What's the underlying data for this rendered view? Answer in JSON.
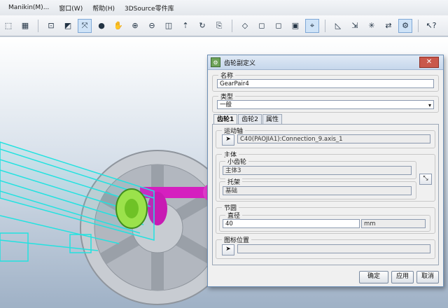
{
  "menubar": {
    "items": [
      "Manikin(M)...",
      "窗口(W)",
      "帮助(H)",
      "3DSource零件库"
    ]
  },
  "colors": {
    "gear_wheel": "#c8ccd2",
    "joint_magenta": "#d51fbf",
    "frame_cyan": "#22e2e0",
    "gear_green": "#9be24b"
  },
  "toolbar": {
    "icons": [
      "select-icon",
      "fit-all-icon",
      "zoom-area-icon",
      "rotate-icon",
      "render-icon",
      "pan-icon",
      "zoom-in-icon",
      "zoom-out-icon",
      "normal-view-icon",
      "fly-icon",
      "turn-icon",
      "view-icon",
      "iso-view-icon",
      "front-view-icon",
      "back-view-icon",
      "left-view-icon",
      "top-view-icon",
      "shading-icon",
      "edges-icon",
      "hide-icon",
      "swap-icon",
      "compass-icon",
      "measure-icon",
      "help-icon"
    ]
  },
  "dialog": {
    "title": "齿轮副定义",
    "close_symbol": "✕",
    "name_label": "名称",
    "name_value": "GearPair4",
    "type_label": "类型",
    "type_value": "一般",
    "tabs": [
      "齿轮1",
      "齿轮2",
      "属性"
    ],
    "motion_axis_label": "运动轴",
    "motion_axis_value": "C40(PAOJIA1):Connection_9.axis_1",
    "body_label": "主体",
    "small_gear_label": "小齿轮",
    "small_gear_value": "主体3",
    "carrier_label": "托架",
    "carrier_value": "基础",
    "pitch_circle_label": "节圆",
    "diameter_label": "直径",
    "diameter_value": "40",
    "diameter_unit": "mm",
    "icon_position_label": "图标位置",
    "icon_position_value": "",
    "ok_label": "确定",
    "apply_label": "应用",
    "cancel_label": "取消"
  }
}
